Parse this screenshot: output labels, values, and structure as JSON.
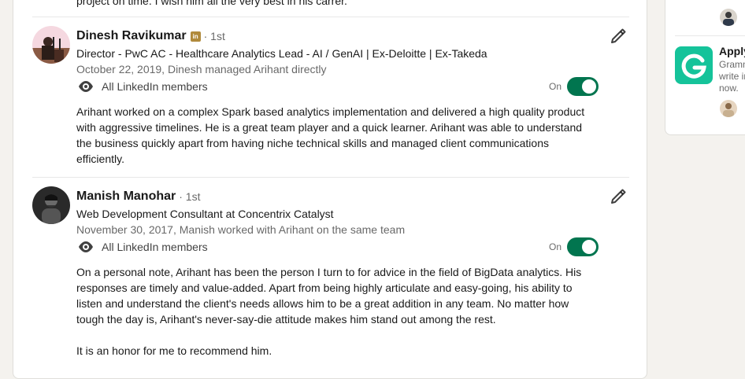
{
  "previous_recommendation": {
    "tail_text": "project on time. I wish him all the very best in his carrer."
  },
  "recommendations": [
    {
      "name": "Dinesh Ravikumar",
      "degree": "· 1st",
      "has_linkedin_badge": true,
      "badge_text": "in",
      "headline": "Director - PwC AC - Healthcare Analytics Lead - AI / GenAI | Ex-Deloitte | Ex-Takeda",
      "meta": "October 22, 2019, Dinesh managed Arihant directly",
      "visibility_label": "All LinkedIn members",
      "toggle_label": "On",
      "toggle_on": true,
      "text": "Arihant worked on a complex Spark based analytics implementation and delivered a high quality product with aggressive timelines. He is a great team player and a quick learner. Arihant was able to understand the business quickly apart from having niche technical skills and managed client communications efficiently."
    },
    {
      "name": "Manish Manohar",
      "degree": "· 1st",
      "has_linkedin_badge": false,
      "headline": "Web Development Consultant at Concentrix Catalyst",
      "meta": "November 30, 2017, Manish worked with Arihant on the same team",
      "visibility_label": "All LinkedIn members",
      "toggle_label": "On",
      "toggle_on": true,
      "text_paragraph_1": "On a personal note, Arihant has been the person I turn to for advice in the field of BigData analytics. His responses are timely and value-added. Apart from being highly articulate and easy-going, his ability to listen and understand the client's needs allows him to be a great addition in any team. No matter how tough the day is, Arihant's never-say-die attitude makes him stand out among the rest.",
      "text_paragraph_2": "It is an honor for me to recommend him."
    }
  ],
  "sidebar": {
    "ad_title": "Apply",
    "ad_lines": [
      "Gramm",
      "write in",
      "now."
    ],
    "ad_logo": "grammarly-logo",
    "accent": "#15c39a"
  },
  "colors": {
    "toggle_on": "#01754f",
    "badge": "#b08a3c",
    "page_bg": "#f4f2ee"
  },
  "icons": {
    "visibility": "eye-icon",
    "edit": "pencil-icon"
  }
}
